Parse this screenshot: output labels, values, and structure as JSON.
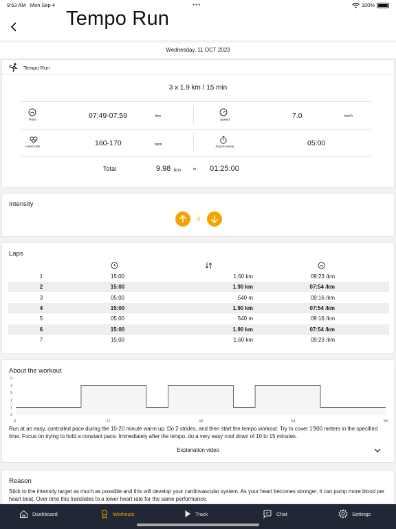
{
  "status": {
    "time": "9:53 AM",
    "date": "Mon Sep 4",
    "battery": "100%"
  },
  "header": {
    "title": "Tempo Run"
  },
  "date_bar": "Wednesday, 11 OCT 2023",
  "workout": {
    "name": "Tempo Run",
    "reps": "3 x 1.9 km / 15 min",
    "pace": {
      "label": "Pace",
      "value": "07:49-07:59",
      "unit": "/km"
    },
    "speed": {
      "label": "Speed",
      "value": "7.0",
      "unit": "km/h"
    },
    "heart_rate": {
      "label": "Heart rate",
      "value": "160-170",
      "unit": "bpm"
    },
    "jog_recovery": {
      "label": "Jog recovery",
      "value": "05:00"
    },
    "total": {
      "label": "Total",
      "distance": "9.98",
      "distance_unit": "km",
      "in_label": "in",
      "time": "01:25:00"
    }
  },
  "intensity": {
    "title": "Intensity",
    "value": "4"
  },
  "laps": {
    "title": "Laps",
    "rows": [
      {
        "n": "1",
        "time": "15:00",
        "distance": "1.60 km",
        "pace": "09:23 /km",
        "highlight": false
      },
      {
        "n": "2",
        "time": "15:00",
        "distance": "1.90 km",
        "pace": "07:54 /km",
        "highlight": true
      },
      {
        "n": "3",
        "time": "05:00",
        "distance": "540 m",
        "pace": "09:16 /km",
        "highlight": false
      },
      {
        "n": "4",
        "time": "15:00",
        "distance": "1.90 km",
        "pace": "07:54 /km",
        "highlight": true
      },
      {
        "n": "5",
        "time": "05:00",
        "distance": "540 m",
        "pace": "09:16 /km",
        "highlight": false
      },
      {
        "n": "6",
        "time": "15:00",
        "distance": "1.90 km",
        "pace": "07:54 /km",
        "highlight": true
      },
      {
        "n": "7",
        "time": "15:00",
        "distance": "1.60 km",
        "pace": "09:23 /km",
        "highlight": false
      }
    ]
  },
  "about": {
    "title": "About the workout",
    "chart_data": {
      "type": "step",
      "y_ticks": [
        "0",
        "1",
        "2",
        "3",
        "4",
        "5"
      ],
      "x_ticks": [
        "0'",
        "21'",
        "43'",
        "64'",
        "85'"
      ],
      "ylim": [
        0,
        5
      ],
      "xlim": [
        0,
        85
      ],
      "steps": [
        {
          "start": 0,
          "end": 15,
          "level": 1
        },
        {
          "start": 15,
          "end": 30,
          "level": 4
        },
        {
          "start": 30,
          "end": 35,
          "level": 1
        },
        {
          "start": 35,
          "end": 50,
          "level": 4
        },
        {
          "start": 50,
          "end": 55,
          "level": 1
        },
        {
          "start": 55,
          "end": 70,
          "level": 4
        },
        {
          "start": 70,
          "end": 85,
          "level": 1
        }
      ]
    },
    "description": "Run at an easy, controlled pace during the 10-20 minute warm up. Do 2 strides, and then start the tempo workout. Try to cover 1'900 meters in the specified time. Focus on trying to hold a constant pace. Immediately after the tempo, do a very easy cool down of 10 to 15 minutes.",
    "video_label": "Explanation video"
  },
  "reason": {
    "title": "Reason",
    "text": "Stick to the intensity target as much as possible and this will develop your  cardiovascular system. As your heart becomes stronger, it can pump more blood per heart beat. Over time this translates to a lower heart rate for the same performance."
  },
  "tabs": [
    {
      "label": "Dashboard",
      "icon": "home-icon",
      "active": false
    },
    {
      "label": "Workouts",
      "icon": "medal-icon",
      "active": true
    },
    {
      "label": "Track",
      "icon": "play-icon",
      "active": false
    },
    {
      "label": "Chat",
      "icon": "chat-icon",
      "active": false
    },
    {
      "label": "Settings",
      "icon": "gear-icon",
      "active": false
    }
  ],
  "colors": {
    "accent": "#f5a300",
    "tabbar": "#212734"
  }
}
